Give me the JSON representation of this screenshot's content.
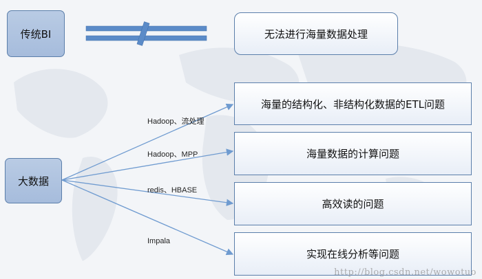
{
  "nodes": {
    "traditional_bi": "传统BI",
    "big_data": "大数据",
    "cannot_process": "无法进行海量数据处理",
    "etl_problem": "海量的结构化、非结构化数据的ETL问题",
    "compute_problem": "海量数据的计算问题",
    "fast_read_problem": "高效读的问题",
    "online_analysis_problem": "实现在线分析等问题"
  },
  "edge_labels": {
    "hadoop_stream": "Hadoop、流处理",
    "hadoop_mpp": "Hadoop、MPP",
    "redis_hbase": "redis、HBASE",
    "impala": "Impala"
  },
  "watermark": "http://blog.csdn.net/wowotuo",
  "colors": {
    "left_box_fill": "#aec2df",
    "box_border": "#5a7eaa",
    "arrow": "#6f9bd0",
    "broken_bar": "#5b8bc8"
  }
}
